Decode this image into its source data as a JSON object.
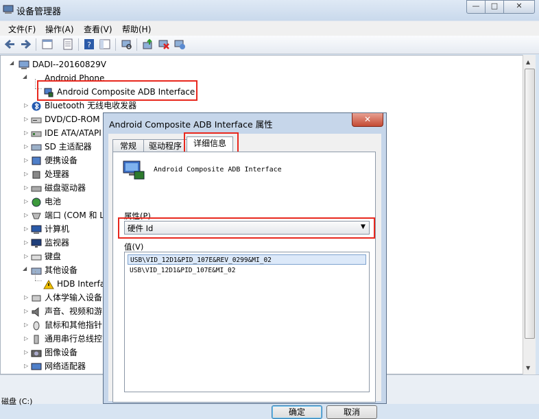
{
  "window": {
    "title": "设备管理器",
    "controls": [
      "—",
      "□",
      "✕"
    ]
  },
  "menu": [
    "文件(F)",
    "操作(A)",
    "查看(V)",
    "帮助(H)"
  ],
  "toolbar_icons": [
    "back-icon",
    "forward-icon",
    "properties-icon",
    "list-icon",
    "help-icon",
    "panel-icon",
    "scan-icon",
    "update-driver-icon",
    "disable-icon",
    "uninstall-icon"
  ],
  "tree": {
    "root": "DADI--20160829V",
    "android_phone": "Android Phone",
    "android_adb": "Android Composite ADB Interface",
    "items": [
      "Bluetooth 无线电收发器",
      "DVD/CD-ROM",
      "IDE ATA/ATAPI",
      "SD 主适配器",
      "便携设备",
      "处理器",
      "磁盘驱动器",
      "电池",
      "端口 (COM 和 L",
      "计算机",
      "监视器",
      "键盘",
      "其他设备",
      "HDB Interfa",
      "人体学输入设备",
      "声音、视频和游",
      "鼠标和其他指针",
      "通用串行总线控",
      "图像设备",
      "网络适配器"
    ]
  },
  "status_text": "磁盘 (C:)",
  "dialog": {
    "title": "Android Composite ADB Interface 属性",
    "close": "✕",
    "tabs": [
      "常规",
      "驱动程序",
      "详细信息"
    ],
    "device_name": "Android Composite ADB Interface",
    "property_label": "属性(P)",
    "property_value": "硬件 Id",
    "value_label": "值(V)",
    "values": [
      "USB\\VID_12D1&PID_107E&REV_0299&MI_02",
      "USB\\VID_12D1&PID_107E&MI_02"
    ],
    "ok": "确定",
    "cancel": "取消"
  },
  "colors": {
    "highlight_box": "#e8271d",
    "selected_row": "#dce9f9"
  }
}
